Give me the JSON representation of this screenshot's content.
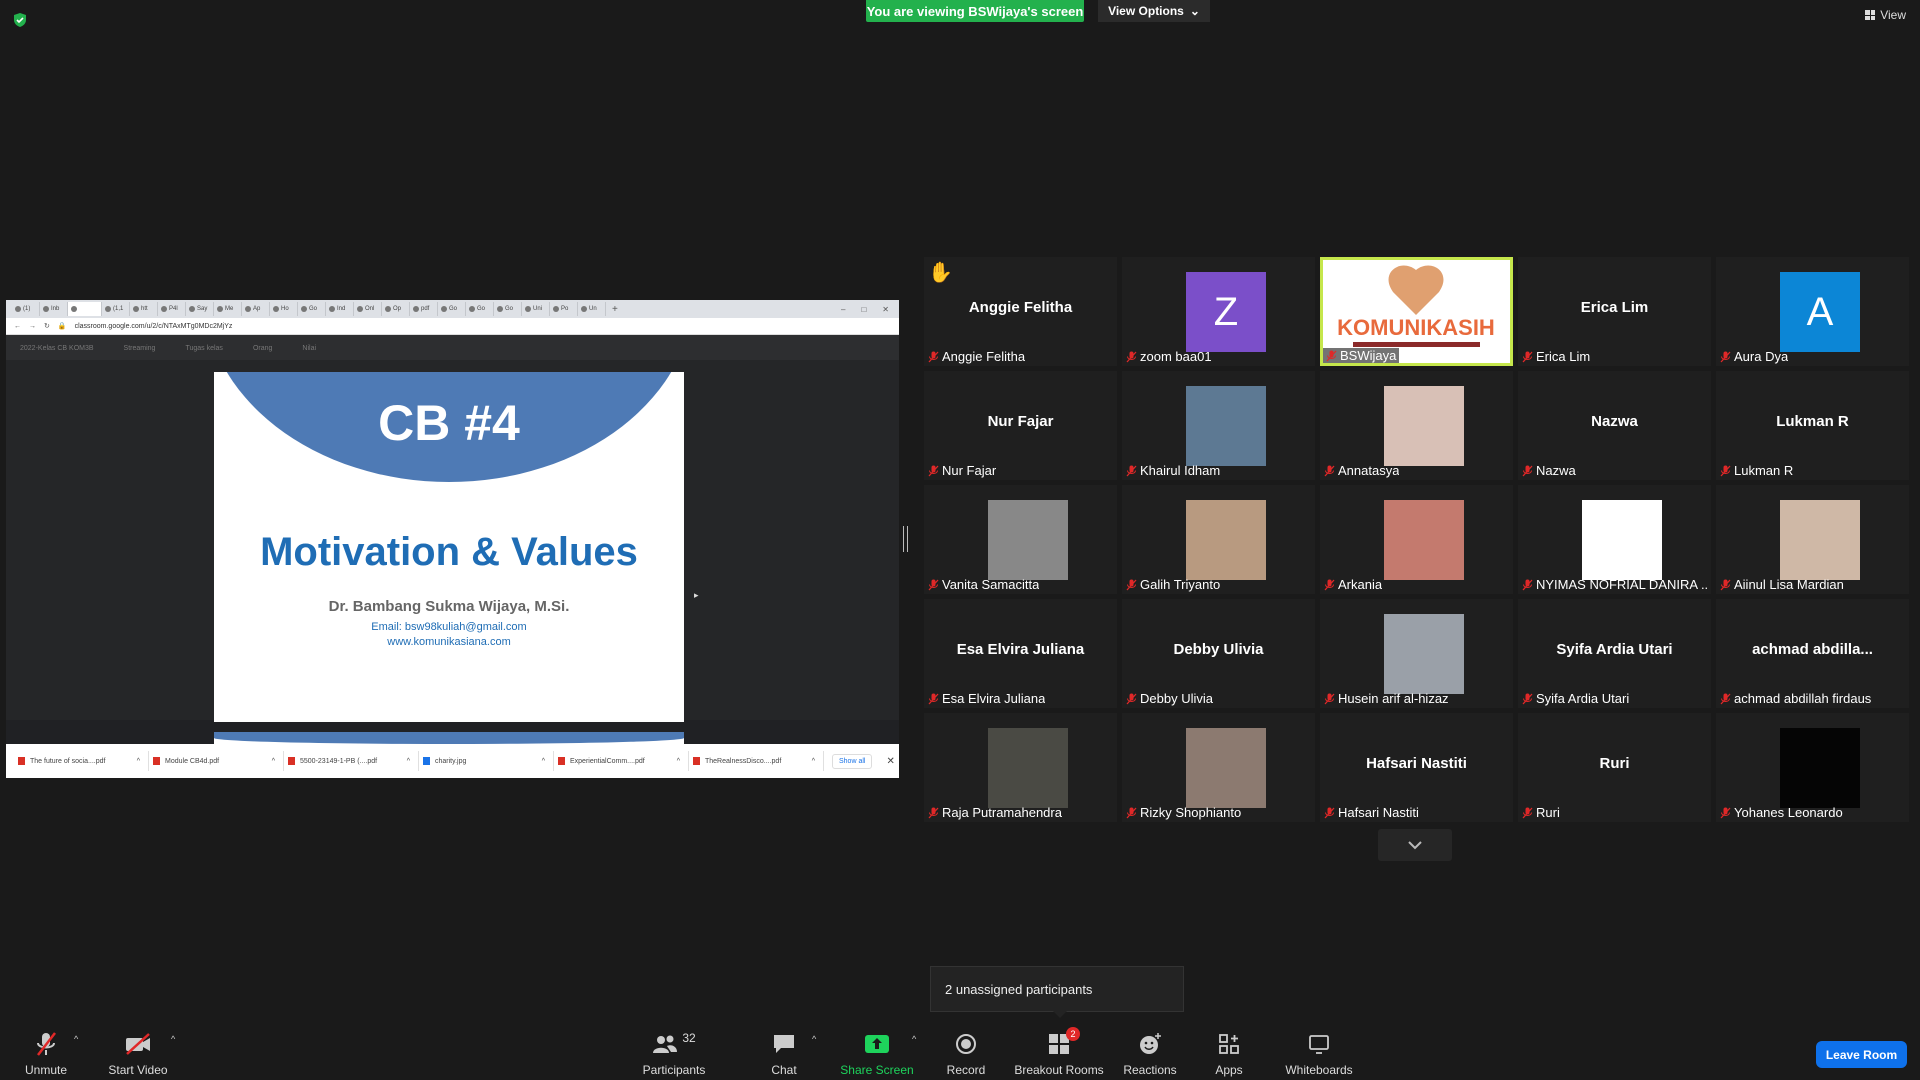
{
  "header": {
    "banner": "You are viewing BSWijaya's screen",
    "view_options": "View Options",
    "view": "View"
  },
  "share": {
    "tabs": [
      "(1)",
      "Inb",
      "",
      "(1,1",
      "htt",
      "P4l",
      "Say",
      "Me",
      "Ap",
      "Ho",
      "Go",
      "Ind",
      "Onl",
      "Op",
      "pdf",
      "Go",
      "Go",
      "Go",
      "Uni",
      "Po",
      "Un"
    ],
    "url": "classroom.google.com/u/2/c/NTAxMTg0MDc2MjYz",
    "classroom_title": "2022-Kelas CB KOM3B",
    "classroom_nav": [
      "Streaming",
      "Tugas kelas",
      "Orang",
      "Nilai"
    ],
    "slide": {
      "title": "CB #4",
      "subtitle": "Motivation & Values",
      "author": "Dr. Bambang Sukma Wijaya, M.Si.",
      "email": "Email: bsw98kuliah@gmail.com",
      "web": "www.komunikasiana.com"
    },
    "downloads": [
      "The future of socia....pdf",
      "Module CB4d.pdf",
      "5500-23149-1-PB (....pdf",
      "charity.jpg",
      "ExperientialComm....pdf",
      "TheRealnessDisco....pdf"
    ],
    "show_all": "Show all"
  },
  "participants": [
    {
      "name": "Anggie Felitha",
      "big": "Anggie Felitha",
      "hand": true
    },
    {
      "name": "zoom baa01",
      "avatar": "Z",
      "color": "#7b4fc9"
    },
    {
      "name": "BSWijaya",
      "speaker": true
    },
    {
      "name": "Erica Lim",
      "big": "Erica Lim"
    },
    {
      "name": "Aura Dya",
      "avatar": "A",
      "color": "#0c86d6"
    },
    {
      "name": "Nur Fajar",
      "big": "Nur Fajar"
    },
    {
      "name": "Khairul Idham",
      "photo": "#5d7993"
    },
    {
      "name": "Annatasya",
      "photo": "#d8c0b6"
    },
    {
      "name": "Nazwa",
      "big": "Nazwa"
    },
    {
      "name": "Lukman R",
      "big": "Lukman R"
    },
    {
      "name": "Vanita Samacitta",
      "photo": "#888888"
    },
    {
      "name": "Galih Triyanto",
      "photo": "#b89a80"
    },
    {
      "name": "Arkania",
      "photo": "#c47a6e"
    },
    {
      "name": "NYIMAS NOFRIAL DANIRA ...",
      "photo": "#ffffff"
    },
    {
      "name": "Aiinul Lisa Mardian",
      "photo": "#cfb8a6"
    },
    {
      "name": "Esa Elvira Juliana",
      "big": "Esa Elvira Juliana"
    },
    {
      "name": "Debby Ulivia",
      "big": "Debby Ulivia"
    },
    {
      "name": "Husein arif al-hizaz",
      "photo": "#9aa0a8"
    },
    {
      "name": "Syifa Ardia Utari",
      "big": "Syifa Ardia Utari"
    },
    {
      "name": "achmad abdillah firdaus",
      "big": "achmad  abdilla..."
    },
    {
      "name": "Raja Putramahendra",
      "photo": "#4a4a44"
    },
    {
      "name": "Rizky Shophianto",
      "photo": "#8c7a70"
    },
    {
      "name": "Hafsari Nastiti",
      "big": "Hafsari Nastiti"
    },
    {
      "name": "Ruri",
      "big": "Ruri"
    },
    {
      "name": "Yohanes Leonardo",
      "photo": "#050505"
    }
  ],
  "tooltip": "2 unassigned participants",
  "toolbar": {
    "unmute": "Unmute",
    "start_video": "Start Video",
    "participants": "Participants",
    "participants_count": "32",
    "chat": "Chat",
    "share_screen": "Share Screen",
    "record": "Record",
    "breakout_rooms": "Breakout Rooms",
    "breakout_badge": "2",
    "reactions": "Reactions",
    "apps": "Apps",
    "whiteboards": "Whiteboards",
    "leave": "Leave Room"
  }
}
